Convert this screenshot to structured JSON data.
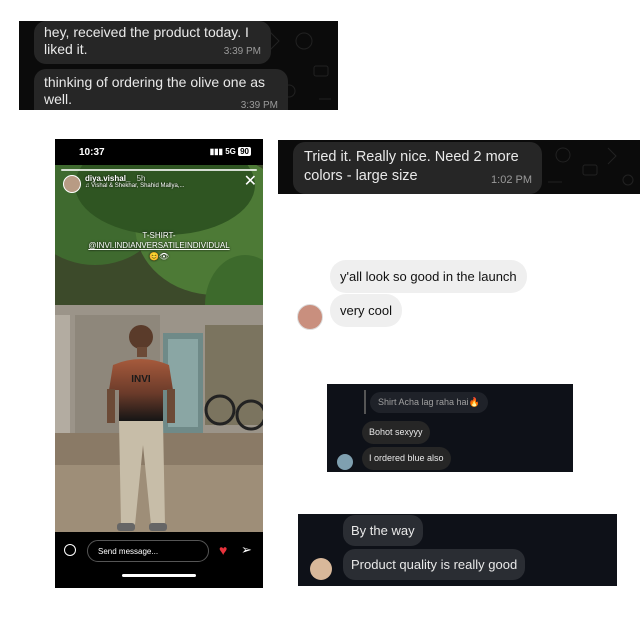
{
  "whatsapp_top": {
    "messages": [
      {
        "text": "hey, received the product today. I liked it.",
        "time": "3:39 PM"
      },
      {
        "text": "thinking of ordering the olive one as well.",
        "time": "3:39 PM"
      }
    ]
  },
  "whatsapp_right": {
    "message": {
      "text": "Tried it. Really nice. Need 2 more colors - large size",
      "time": "1:02 PM"
    }
  },
  "story": {
    "status_time": "10:37",
    "network": "5G",
    "battery": "90",
    "username": "diya.vishal_",
    "posted_ago": "5h",
    "music": "Vishal & Shekhar, Shahid Mallya,...",
    "caption_line1": "T-SHIRT-",
    "caption_line2": "@INVI.INDIANVERSATILEINDIVIDUAL",
    "shirt_text": "INVI",
    "message_placeholder": "Send message..."
  },
  "ig_chat": {
    "messages": [
      "y'all look so good in the launch",
      "very cool"
    ]
  },
  "dm_dark": {
    "reply_preview": "Shirt Acha lag raha hai🔥",
    "messages": [
      "Bohot sexyyy",
      "I ordered blue also"
    ]
  },
  "dm_bottom": {
    "messages": [
      "By the way",
      "Product quality is really good"
    ]
  },
  "colors": {
    "whatsapp_bg": "#0b0b0b",
    "whatsapp_bubble": "#262626",
    "ig_light_bubble": "#efefef",
    "ig_dark_bg": "#0e1118",
    "like_heart": "#e8323c"
  }
}
